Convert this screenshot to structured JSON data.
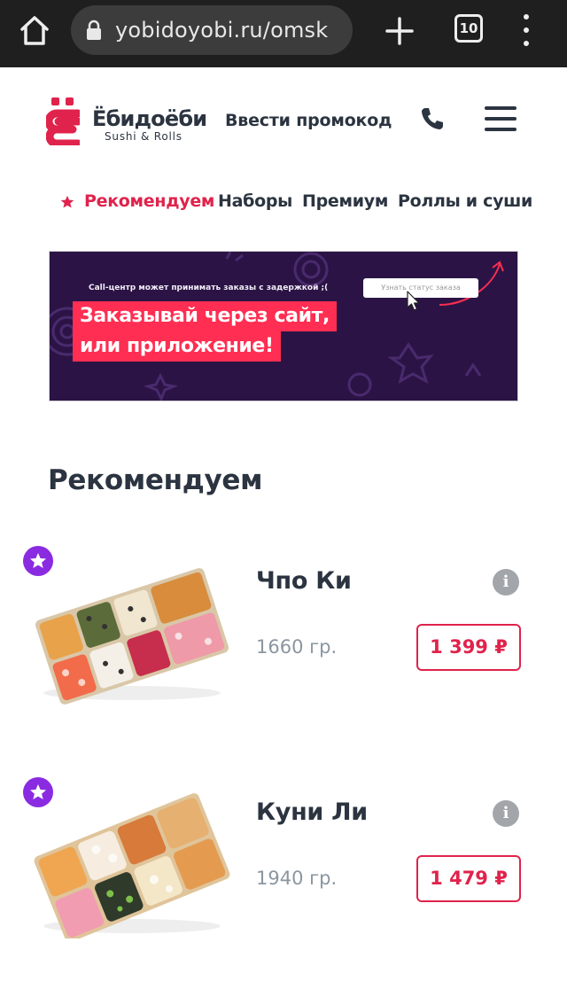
{
  "browser": {
    "url": "yobidoyobi.ru/omsk",
    "tab_count": "10"
  },
  "header": {
    "logo_title": "Ёбидоёби",
    "logo_subtitle": "Sushi & Rolls",
    "promo_label": "Ввести промокод"
  },
  "categories": [
    {
      "label": "Рекомендуем",
      "active": true
    },
    {
      "label": "Наборы"
    },
    {
      "label": "Премиум"
    },
    {
      "label": "Роллы и суши"
    }
  ],
  "banner": {
    "note": "Call-центр может принимать заказы с задержкой ;(",
    "button_label": "Узнать статус заказа",
    "headline_line1": "Заказывай через сайт,",
    "headline_line2": "или приложение!"
  },
  "section": {
    "title": "Рекомендуем"
  },
  "products": [
    {
      "name": "Чпо Ки",
      "weight": "1660 гр.",
      "price": "1 399 ₽",
      "info_glyph": "i"
    },
    {
      "name": "Куни Ли",
      "weight": "1940 гр.",
      "price": "1 479 ₽",
      "info_glyph": "i"
    }
  ],
  "colors": {
    "accent": "#e0234c",
    "text_dark": "#2b3440",
    "favorite_badge": "#8a2be2",
    "banner_bg": "#2b1445",
    "banner_highlight": "#ff2e52",
    "browser_bar": "#1f1f1f"
  },
  "icons": {
    "home": "home-icon",
    "lock": "lock-icon",
    "new_tab": "plus-icon",
    "overflow": "kebab-menu-icon",
    "phone": "phone-icon",
    "menu": "hamburger-menu-icon",
    "favorite": "star-icon",
    "info": "info-icon"
  }
}
